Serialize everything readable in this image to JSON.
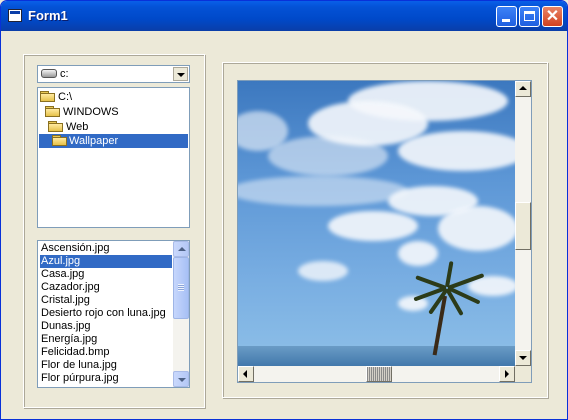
{
  "window": {
    "title": "Form1"
  },
  "drive": {
    "value": "c:"
  },
  "dirs": [
    {
      "label": "C:\\",
      "selected": false
    },
    {
      "label": "WINDOWS",
      "selected": false
    },
    {
      "label": "Web",
      "selected": false
    },
    {
      "label": "Wallpaper",
      "selected": true
    }
  ],
  "files": [
    {
      "label": "Ascensión.jpg",
      "selected": false
    },
    {
      "label": "Azul.jpg",
      "selected": true
    },
    {
      "label": "Casa.jpg",
      "selected": false
    },
    {
      "label": "Cazador.jpg",
      "selected": false
    },
    {
      "label": "Cristal.jpg",
      "selected": false
    },
    {
      "label": "Desierto rojo con luna.jpg",
      "selected": false
    },
    {
      "label": "Dunas.jpg",
      "selected": false
    },
    {
      "label": "Energía.jpg",
      "selected": false
    },
    {
      "label": "Felicidad.bmp",
      "selected": false
    },
    {
      "label": "Flor de luna.jpg",
      "selected": false
    },
    {
      "label": "Flor púrpura.jpg",
      "selected": false
    }
  ],
  "colors": {
    "selection": "#316ac5",
    "titlebar": "#0a5fe8"
  }
}
